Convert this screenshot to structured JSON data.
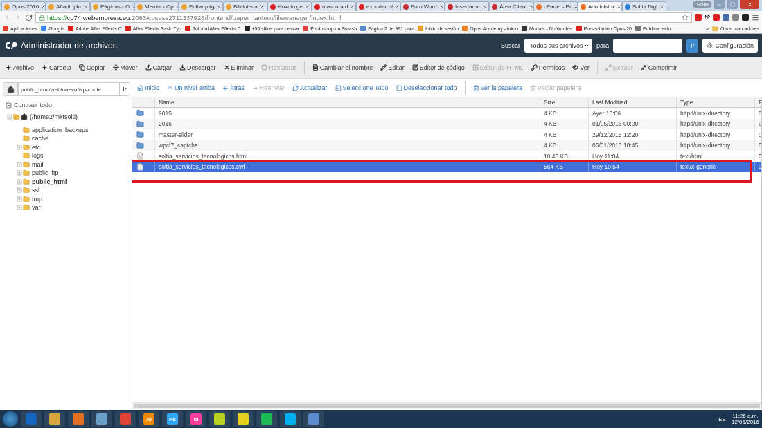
{
  "browser": {
    "tabs": [
      {
        "title": "Opus 2016",
        "color": "#f0a030",
        "selected": false
      },
      {
        "title": "Añadir plu",
        "color": "#f0a030",
        "selected": false
      },
      {
        "title": "Páginas ‹ O",
        "color": "#f0a030",
        "selected": false
      },
      {
        "title": "Menús ‹ Op",
        "color": "#f0a030",
        "selected": false
      },
      {
        "title": "Editar pág",
        "color": "#f0a030",
        "selected": false
      },
      {
        "title": "Biblioteca",
        "color": "#f0a030",
        "selected": false
      },
      {
        "title": "How to ge",
        "color": "#e02020",
        "selected": false
      },
      {
        "title": "mascara d",
        "color": "#e02020",
        "selected": false
      },
      {
        "title": "exportar ht",
        "color": "#e02020",
        "selected": false
      },
      {
        "title": "Foro Word",
        "color": "#c8282e",
        "selected": false
      },
      {
        "title": "Insertar ar",
        "color": "#c8282e",
        "selected": false
      },
      {
        "title": "Área Client",
        "color": "#c8282e",
        "selected": false
      },
      {
        "title": "cPanel - Pr",
        "color": "#f07020",
        "selected": false
      },
      {
        "title": "Administra",
        "color": "#f07020",
        "selected": true
      },
      {
        "title": "Soltia Digi",
        "color": "#2a7fd4",
        "selected": false
      }
    ],
    "user": "Soltia",
    "url": {
      "scheme": "https://",
      "host": "cp74.webempresa.eu",
      "rest": ":2083/cpsess2711337928/frontend/paper_lantern/filemanager/index.html"
    },
    "extensions": [
      {
        "color": "#e0201c"
      },
      {
        "label": "f?",
        "color": "#222222"
      },
      {
        "color": "#d42020"
      },
      {
        "color": "#4a6ea8"
      },
      {
        "color": "#888888"
      },
      {
        "color": "#222222"
      }
    ],
    "bookmarks": [
      {
        "title": "Aplicaciones",
        "color": "#e04030"
      },
      {
        "title": "Google",
        "color": "#4285f4"
      },
      {
        "title": "Adobe After Effects C",
        "color": "#e02020"
      },
      {
        "title": "After Effects Basic Typ",
        "color": "#e02020"
      },
      {
        "title": "Tutorial After Effects C",
        "color": "#e02020"
      },
      {
        "title": "+50 sitios para descar",
        "color": "#222222"
      },
      {
        "title": "Photoshop on Smash",
        "color": "#e04040"
      },
      {
        "title": "Página 2 de 991 para",
        "color": "#5a8ad0"
      },
      {
        "title": "Inicio de sesión",
        "color": "#e8a030"
      },
      {
        "title": "Opus Academy - inicio",
        "color": "#f08020"
      },
      {
        "title": "Modals - NoNumber",
        "color": "#333333"
      },
      {
        "title": "Presentación Opus 20",
        "color": "#e02020"
      },
      {
        "title": "Publicar esto",
        "color": "#777777"
      }
    ],
    "more": "»",
    "other_bookmarks": "Otros marcadores"
  },
  "header": {
    "title": "Administrador de archivos",
    "search_label": "Buscar",
    "search_scope": "Todos sus archivos",
    "for_label": "para",
    "go": "Ir",
    "settings": "Configuración"
  },
  "toolbar": [
    {
      "label": "Archivo",
      "disabled": false
    },
    {
      "label": "Carpeta",
      "disabled": false
    },
    {
      "label": "Copiar",
      "disabled": false
    },
    {
      "label": "Mover",
      "disabled": false
    },
    {
      "label": "Cargar",
      "disabled": false
    },
    {
      "label": "Descargar",
      "disabled": false
    },
    {
      "label": "Eliminar",
      "disabled": false
    },
    {
      "label": "Restaurar",
      "disabled": true
    },
    {
      "label": "Cambiar el nombre",
      "disabled": false
    },
    {
      "label": "Editar",
      "disabled": false
    },
    {
      "label": "Editor de código",
      "disabled": false
    },
    {
      "label": "Editor de HTML",
      "disabled": true
    },
    {
      "label": "Permisos",
      "disabled": false
    },
    {
      "label": "Ver",
      "disabled": false
    },
    {
      "label": "Extraer",
      "disabled": true
    },
    {
      "label": "Comprimir",
      "disabled": false
    }
  ],
  "path": {
    "value": "public_html/web/nuevo/wp-conte",
    "go": "Ir"
  },
  "nav": [
    {
      "label": "Inicio",
      "disabled": false
    },
    {
      "label": "Un nivel arriba",
      "disabled": false
    },
    {
      "label": "Atrás",
      "disabled": false
    },
    {
      "label": "Reenviar",
      "disabled": true
    },
    {
      "label": "Actualizar",
      "disabled": false
    },
    {
      "label": "Seleccione Todo",
      "disabled": false
    },
    {
      "label": "Deseleccionar todo",
      "disabled": false
    },
    {
      "label": "Ver la papelera",
      "disabled": false
    },
    {
      "label": "Vaciar papelera",
      "disabled": true
    }
  ],
  "tree": {
    "collapse_all": "Contraer todo",
    "items": [
      {
        "label": "(/home2/mktsolti)",
        "kind": "home",
        "expanded": true,
        "selected": false,
        "children": [
          {
            "label": "application_backups",
            "kind": "leaf",
            "expanded": false,
            "selected": false
          },
          {
            "label": "cache",
            "kind": "leaf",
            "expanded": false,
            "selected": false
          },
          {
            "label": "etc",
            "kind": "branch",
            "expanded": false,
            "selected": false
          },
          {
            "label": "logs",
            "kind": "leaf",
            "expanded": false,
            "selected": false
          },
          {
            "label": "mail",
            "kind": "branch",
            "expanded": false,
            "selected": false
          },
          {
            "label": "public_ftp",
            "kind": "branch",
            "expanded": false,
            "selected": false
          },
          {
            "label": "public_html",
            "kind": "branch",
            "expanded": false,
            "selected": true
          },
          {
            "label": "ssl",
            "kind": "branch",
            "expanded": false,
            "selected": false
          },
          {
            "label": "tmp",
            "kind": "branch",
            "expanded": false,
            "selected": false
          },
          {
            "label": "var",
            "kind": "branch",
            "expanded": false,
            "selected": false
          }
        ]
      }
    ]
  },
  "table": {
    "columns": [
      "Name",
      "Size",
      "Last Modified",
      "Type",
      "F"
    ],
    "rows": [
      {
        "kind": "folder",
        "name": "2015",
        "size": "4 KB",
        "modified": "Ayer 13:06",
        "type": "httpd/unix-directory",
        "column_5": "0",
        "selected": false
      },
      {
        "kind": "folder",
        "name": "2016",
        "size": "4 KB",
        "modified": "01/05/2016 00:00",
        "type": "httpd/unix-directory",
        "column_5": "0",
        "selected": false
      },
      {
        "kind": "folder",
        "name": "master-slider",
        "size": "4 KB",
        "modified": "29/12/2015 12:20",
        "type": "httpd/unix-directory",
        "column_5": "0",
        "selected": false
      },
      {
        "kind": "folder",
        "name": "wpcf7_captcha",
        "size": "4 KB",
        "modified": "06/01/2016 18:45",
        "type": "httpd/unix-directory",
        "column_5": "0",
        "selected": false
      },
      {
        "kind": "web",
        "name": "soltia_servicios_tecnologicos.html",
        "size": "10.43 KB",
        "modified": "Hoy 11:04",
        "type": "text/html",
        "column_5": "0",
        "selected": false
      },
      {
        "kind": "file",
        "name": "soltia_servicios_tecnologicos.swf",
        "size": "564 KB",
        "modified": "Hoy 10:54",
        "type": "text/x-generic",
        "column_5": "0",
        "selected": true
      }
    ],
    "annotation": {
      "kind": "outline"
    }
  },
  "taskbar": {
    "apps": [
      {
        "color": "#1565c0"
      },
      {
        "color": "#d9a640"
      },
      {
        "color": "#e07020"
      },
      {
        "color": "#6aa0c8"
      },
      {
        "color": "#dd4433"
      },
      {
        "label": "Ai",
        "color": "#f08a00"
      },
      {
        "label": "Ps",
        "color": "#31a8ff"
      },
      {
        "label": "Id",
        "color": "#ff3d9a"
      },
      {
        "color": "#b8d020"
      },
      {
        "color": "#e8d020"
      },
      {
        "color": "#1db954"
      },
      {
        "color": "#00aff0"
      },
      {
        "color": "#5a8ad0"
      }
    ],
    "language": "ES",
    "time": "11:26 a.m.",
    "date": "12/05/2016"
  }
}
